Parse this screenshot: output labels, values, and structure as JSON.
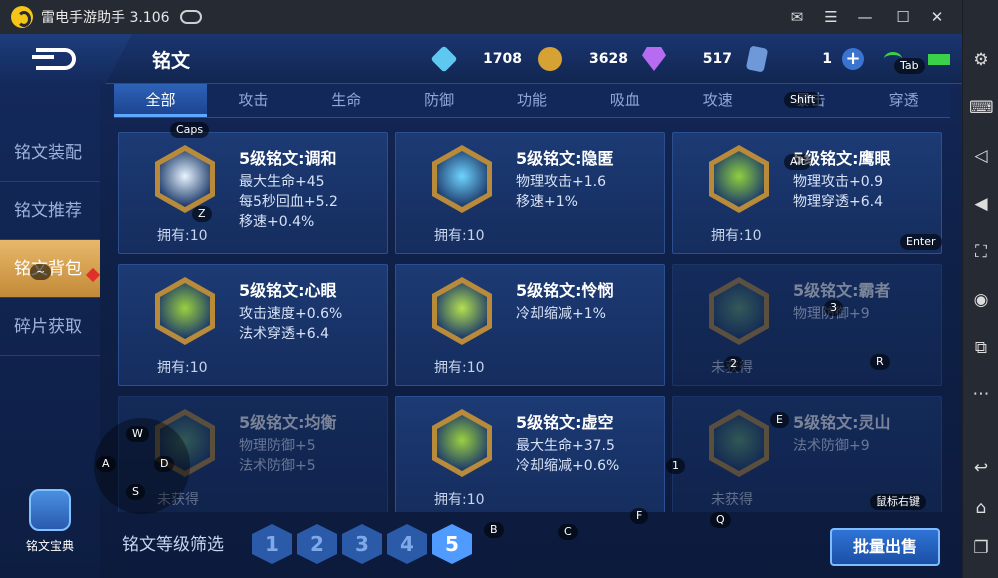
{
  "app": {
    "title": "雷电手游助手 3.106"
  },
  "game": {
    "title": "铭文",
    "resources": [
      {
        "icon": "crystal-icon",
        "value": "1708",
        "color": "#5fc8f0"
      },
      {
        "icon": "coin-icon",
        "value": "3628",
        "color": "#d6a234"
      },
      {
        "icon": "gem-icon",
        "value": "517",
        "color": "#b56cf0"
      },
      {
        "icon": "card-icon",
        "value": "1",
        "color": "#6f98d8"
      }
    ],
    "tabs": [
      "全部",
      "攻击",
      "生命",
      "防御",
      "功能",
      "吸血",
      "攻速",
      "暴击",
      "穿透"
    ],
    "active_tab": "全部",
    "left_menu": [
      "铭文装配",
      "铭文推荐",
      "铭文背包",
      "碎片获取"
    ],
    "active_menu": "铭文背包",
    "codex_label": "铭文宝典",
    "filter_label": "铭文等级筛选",
    "levels": [
      "1",
      "2",
      "3",
      "4",
      "5"
    ],
    "active_level": "5",
    "bulk_sell": "批量出售",
    "cards": [
      {
        "name": "5级铭文:调和",
        "attrs": [
          "最大生命+45",
          "每5秒回血+5.2",
          "移速+0.4%"
        ],
        "owned": "拥有:10",
        "dim": false,
        "color": "#e8f4ff"
      },
      {
        "name": "5级铭文:隐匿",
        "attrs": [
          "物理攻击+1.6",
          "移速+1%"
        ],
        "owned": "拥有:10",
        "dim": false,
        "color": "#6fd3ff"
      },
      {
        "name": "5级铭文:鹰眼",
        "attrs": [
          "物理攻击+0.9",
          "物理穿透+6.4"
        ],
        "owned": "拥有:10",
        "dim": false,
        "color": "#8fd040"
      },
      {
        "name": "5级铭文:心眼",
        "attrs": [
          "攻击速度+0.6%",
          "法术穿透+6.4"
        ],
        "owned": "拥有:10",
        "dim": false,
        "color": "#9ad040"
      },
      {
        "name": "5级铭文:怜悯",
        "attrs": [
          "冷却缩减+1%"
        ],
        "owned": "拥有:10",
        "dim": false,
        "color": "#b4e050"
      },
      {
        "name": "5级铭文:霸者",
        "attrs": [
          "物理防御+9"
        ],
        "owned": "未获得",
        "dim": true,
        "color": "#5fa070"
      },
      {
        "name": "5级铭文:均衡",
        "attrs": [
          "物理防御+5",
          "法术防御+5"
        ],
        "owned": "未获得",
        "dim": true,
        "color": "#5fa070"
      },
      {
        "name": "5级铭文:虚空",
        "attrs": [
          "最大生命+37.5",
          "冷却缩减+0.6%"
        ],
        "owned": "拥有:10",
        "dim": false,
        "color": "#9ad040"
      },
      {
        "name": "5级铭文:灵山",
        "attrs": [
          "法术防御+9"
        ],
        "owned": "未获得",
        "dim": true,
        "color": "#5fa070"
      }
    ]
  },
  "keymap": {
    "caps": "Caps",
    "z": "Z",
    "alt": "Alt",
    "enter": "Enter",
    "shift": "Shift",
    "tab": "Tab",
    "tilde": "~",
    "three": "3",
    "two": "2",
    "r": "R",
    "e": "E",
    "one": "1",
    "w": "W",
    "a": "A",
    "d": "D",
    "s": "S",
    "b": "B",
    "c": "C",
    "f": "F",
    "q": "Q",
    "right_click": "鼠标右键"
  }
}
